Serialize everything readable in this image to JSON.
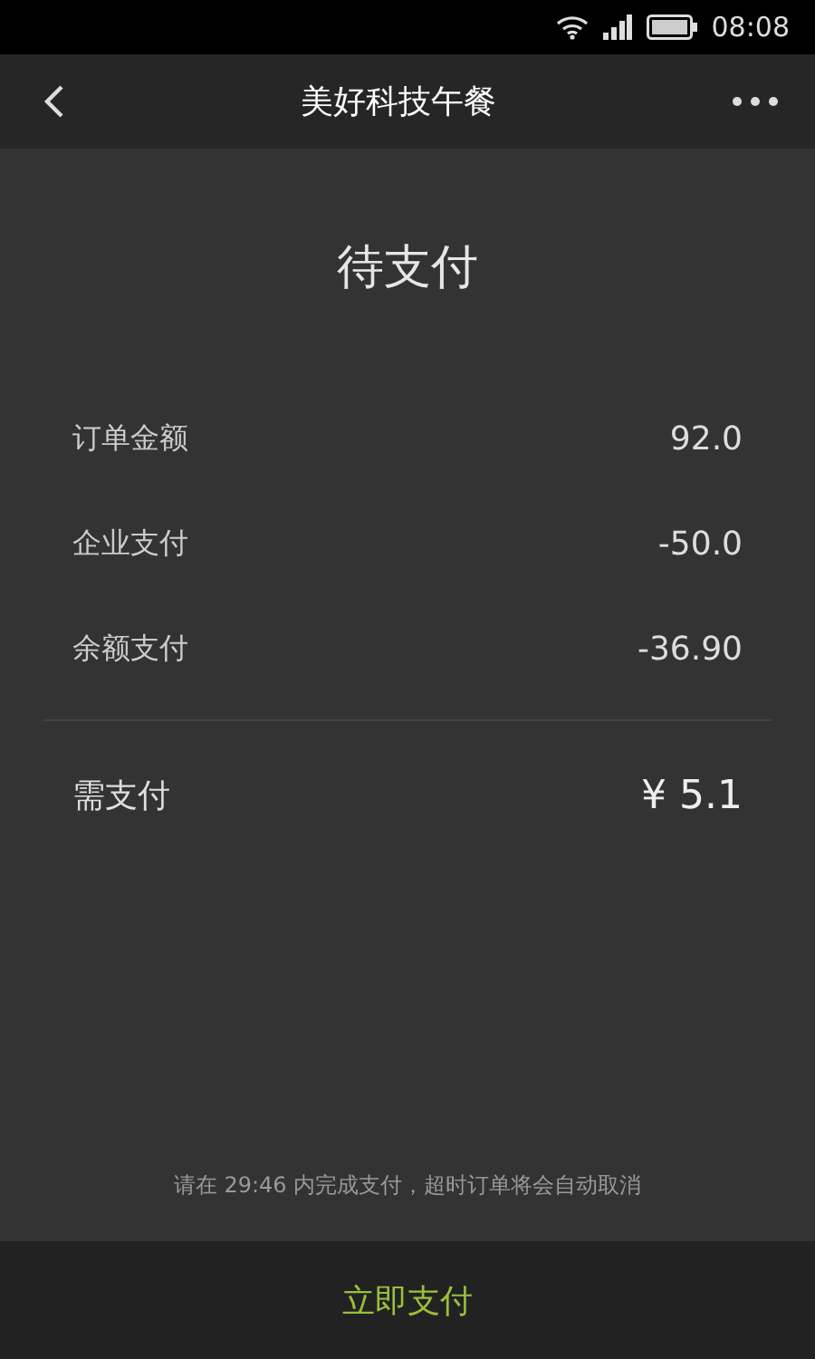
{
  "status_bar": {
    "time": "08:08"
  },
  "header": {
    "title": "美好科技午餐"
  },
  "status_title": "待支付",
  "rows": [
    {
      "label": "订单金额",
      "value": "92.0"
    },
    {
      "label": "企业支付",
      "value": "-50.0"
    },
    {
      "label": "余额支付",
      "value": "-36.90"
    }
  ],
  "total": {
    "label": "需支付",
    "value": "¥ 5.1"
  },
  "notice": "请在 29:46 内完成支付，超时订单将会自动取消",
  "pay_button": "立即支付"
}
